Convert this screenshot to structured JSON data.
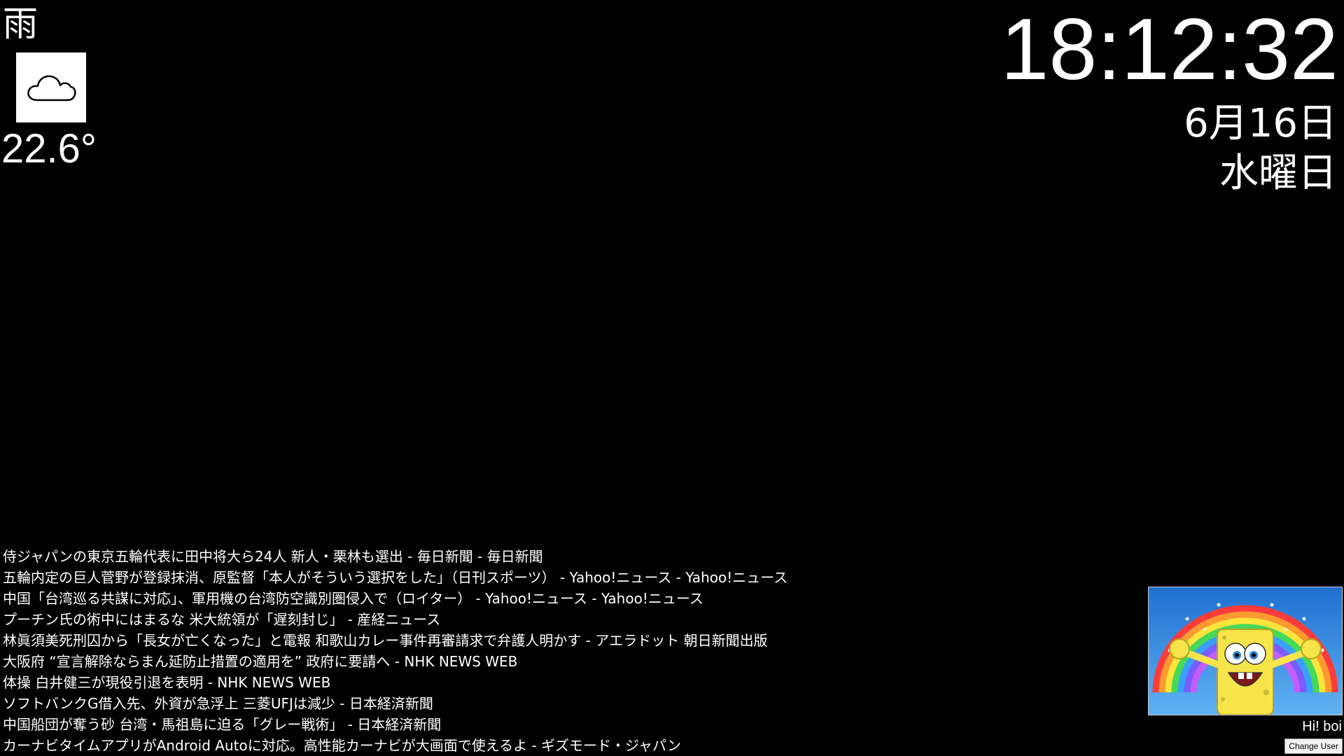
{
  "weather": {
    "condition": "雨",
    "icon": "cloud-icon",
    "temperature": "22.6°"
  },
  "clock": {
    "time": "18:12:32",
    "date": "6月16日",
    "weekday": "水曜日"
  },
  "news": {
    "headlines": [
      "侍ジャパンの東京五輪代表に田中将大ら24人 新人・栗林も選出 - 毎日新聞 - 毎日新聞",
      "五輪内定の巨人菅野が登録抹消、原監督「本人がそういう選択をした」（日刊スポーツ） - Yahoo!ニュース - Yahoo!ニュース",
      "中国「台湾巡る共謀に対応」、軍用機の台湾防空識別圏侵入で（ロイター） - Yahoo!ニュース - Yahoo!ニュース",
      "プーチン氏の術中にはまるな 米大統領が「遅刻封じ」 - 産経ニュース",
      "林眞須美死刑囚から「長女が亡くなった」と電報 和歌山カレー事件再審請求で弁護人明かす - アエラドット 朝日新聞出版",
      "大阪府 “宣言解除ならまん延防止措置の適用を” 政府に要請へ - NHK NEWS WEB",
      "体操 白井健三が現役引退を表明 - NHK NEWS WEB",
      "ソフトバンクG借入先、外資が急浮上 三菱UFJは減少 - 日本経済新聞",
      "中国船団が奪う砂 台湾・馬祖島に迫る「グレー戦術」 - 日本経済新聞",
      "カーナビタイムアプリがAndroid Autoに対応。高性能カーナビが大画面で使えるよ - ギズモード・ジャパン"
    ]
  },
  "user": {
    "greeting": "Hi! boi",
    "change_user_label": "Change User",
    "avatar": "spongebob-rainbow-image"
  }
}
